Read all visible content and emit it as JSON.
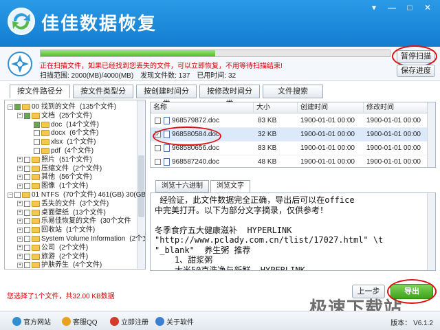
{
  "app": {
    "title": "佳佳数据恢复",
    "version_label": "版本： V6.1.2",
    "colors": {
      "titlebar": "#1f8fde",
      "accent_red": "#d40000",
      "progress": "#4fbe2c"
    }
  },
  "window_controls": {
    "menu": "▾",
    "minimize": "—",
    "maximize": "□",
    "close": "✕"
  },
  "scan": {
    "progress_fraction": 0.5,
    "status_message": "正在扫描文件，如果已经找到您丢失的文件，可以立即恢复，不用等待扫描结束!",
    "range": "扫描范围: 2000(MB)/4000(MB)",
    "found": "发现文件数: 137",
    "elapsed": "已用时间: 32",
    "pause_button": "暂停扫描",
    "save_progress_button": "保存进度"
  },
  "tabs": [
    {
      "label": "按文件路径分类",
      "active": true
    },
    {
      "label": "按文件类型分类",
      "active": false
    },
    {
      "label": "按创建时间分类",
      "active": false
    },
    {
      "label": "按修改时间分类",
      "active": false
    },
    {
      "label": "文件搜索",
      "active": false
    }
  ],
  "tree": [
    {
      "label": "00 找到的文件",
      "count": "(135个文件)",
      "toggle": "−",
      "checked": "partial"
    },
    {
      "label": "文档",
      "count": "(25个文件)",
      "toggle": "−",
      "checked": "partial"
    },
    {
      "label": "doc",
      "count": "(14个文件)",
      "toggle": "",
      "checked": "partial"
    },
    {
      "label": "docx",
      "count": "(6个文件)",
      "toggle": "",
      "checked": "none"
    },
    {
      "label": "xlsx",
      "count": "(1个文件)",
      "toggle": "",
      "checked": "none"
    },
    {
      "label": "pdf",
      "count": "(4个文件)",
      "toggle": "",
      "checked": "none"
    },
    {
      "label": "照片",
      "count": "(51个文件)",
      "toggle": "+",
      "checked": "none"
    },
    {
      "label": "压缩文件",
      "count": "(2个文件)",
      "toggle": "+",
      "checked": "none"
    },
    {
      "label": "其他",
      "count": "(56个文件)",
      "toggle": "+",
      "checked": "none"
    },
    {
      "label": "图像",
      "count": "(1个文件)",
      "toggle": "+",
      "checked": "none"
    },
    {
      "label": "01 NTFS",
      "count": "(70个文件) 461(GB) 30(GB)",
      "toggle": "−",
      "checked": "none"
    },
    {
      "label": "丢失的文件",
      "count": "(3个文件)",
      "toggle": "+",
      "checked": "none"
    },
    {
      "label": "桌面壁纸",
      "count": "(13个文件)",
      "toggle": "+",
      "checked": "none"
    },
    {
      "label": "乐易佳恢复的文件",
      "count": "(30个文件",
      "toggle": "+",
      "checked": "none"
    },
    {
      "label": "回收站",
      "count": "(1个文件)",
      "toggle": "+",
      "checked": "none"
    },
    {
      "label": "System Volume Information",
      "count": "(2个文",
      "toggle": "+",
      "checked": "none"
    },
    {
      "label": "公司",
      "count": "(2个文件)",
      "toggle": "+",
      "checked": "none"
    },
    {
      "label": "旅游",
      "count": "(2个文件)",
      "toggle": "+",
      "checked": "none"
    },
    {
      "label": "护肤养生",
      "count": "(4个文件)",
      "toggle": "+",
      "checked": "none"
    }
  ],
  "file_list": {
    "columns": [
      "名称",
      "大小",
      "创建时间",
      "修改时间"
    ],
    "rows": [
      {
        "name": "968579872.doc",
        "size": "83 KB",
        "created": "1900-01-01 00:00",
        "modified": "1900-01-01 00:00",
        "checked": false,
        "selected": false
      },
      {
        "name": "968580584.doc",
        "size": "32 KB",
        "created": "1900-01-01 00:00",
        "modified": "1900-01-01 00:00",
        "checked": true,
        "selected": true
      },
      {
        "name": "968580656.doc",
        "size": "83 KB",
        "created": "1900-01-01 00:00",
        "modified": "1900-01-01 00:00",
        "checked": false,
        "selected": false
      },
      {
        "name": "968587240.doc",
        "size": "48 KB",
        "created": "1900-01-01 00:00",
        "modified": "1900-01-01 00:00",
        "checked": false,
        "selected": false
      }
    ]
  },
  "preview": {
    "tabs": [
      {
        "label": "浏览十六进制",
        "active": false
      },
      {
        "label": "浏览文字",
        "active": true
      }
    ],
    "lines": [
      " 经验证，此文件数据完全正确，导出后可以在office",
      "中完美打开。以下为部分文字摘录，仅供参考！",
      "",
      "冬季食疗五大健康滋补  HYPERLINK",
      "\"http://www.pclady.com.cn/tlist/17027.html\" \\t",
      "\"_blank\"  养生粥 推荐",
      "    1、甜浆粥",
      "    大米50克洗净与新鲜  HYPERLINK"
    ]
  },
  "footer": {
    "selected_info": "您选择了1个文件，共32.00 KB数据",
    "prev_button": "上一步",
    "export_button": "导出",
    "links": [
      "官方网站",
      "客服QQ",
      "立即注册",
      "关于软件"
    ],
    "watermark": "极速下载站"
  }
}
